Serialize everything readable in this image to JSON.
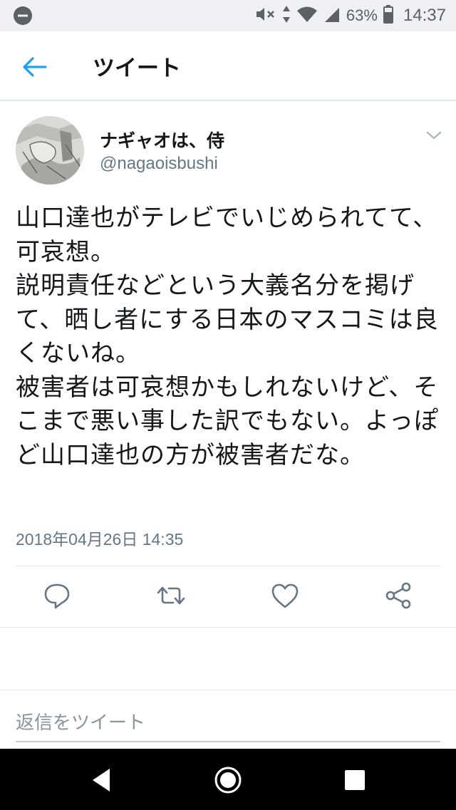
{
  "status_bar": {
    "battery_percent": "63%",
    "time": "14:37",
    "icons": [
      "minus-circle-icon",
      "mute-icon",
      "data-arrows-icon",
      "wifi-icon",
      "signal-icon",
      "battery-icon"
    ]
  },
  "app_bar": {
    "title": "ツイート",
    "back_icon": "back-arrow-icon",
    "accent_color": "#1da1f2"
  },
  "tweet": {
    "display_name": "ナギャオは、侍",
    "handle": "@nagaoisbushi",
    "text": "山口達也がテレビでいじめられてて、可哀想。\n説明責任などという大義名分を掲げて、晒し者にする日本のマスコミは良くないね。\n被害者は可哀想かもしれないけど、そこまで悪い事した訳でもない。よっぽど山口達也の方が被害者だな。",
    "timestamp": "2018年04月26日 14:35",
    "caret_icon": "chevron-down-icon"
  },
  "actions": {
    "icons": [
      "reply-icon",
      "retweet-icon",
      "like-icon",
      "share-icon"
    ]
  },
  "reply_box": {
    "placeholder": "返信をツイート"
  },
  "nav_bar": {
    "icons": [
      "back-triangle-icon",
      "home-circle-icon",
      "recents-square-icon"
    ]
  }
}
